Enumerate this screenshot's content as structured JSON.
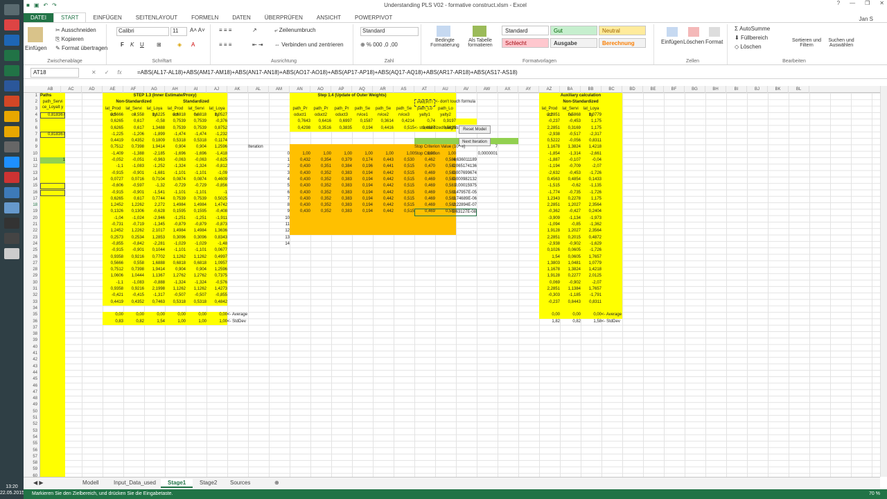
{
  "titlebar": {
    "title": "Understanding PLS V02 - formative construct.xlsm - Excel"
  },
  "clock": {
    "time": "13:20",
    "date": "22.05.2015"
  },
  "tabs": {
    "file": "DATEI",
    "start": "START",
    "insert": "EINFÜGEN",
    "layout": "SEITENLAYOUT",
    "formulas": "FORMELN",
    "data": "DATEN",
    "review": "ÜBERPRÜFEN",
    "view": "ANSICHT",
    "powerpivot": "POWERPIVOT",
    "user": "Jan S"
  },
  "ribbon": {
    "clipboard": {
      "label": "Zwischenablage",
      "paste": "Einfügen",
      "cut": "Ausschneiden",
      "copy": "Kopieren",
      "painter": "Format übertragen"
    },
    "font": {
      "label": "Schriftart",
      "name": "Calibri",
      "size": "11"
    },
    "align": {
      "label": "Ausrichtung",
      "wrap": "Zeilenumbruch",
      "merge": "Verbinden und zentrieren"
    },
    "number": {
      "label": "Zahl",
      "format": "Standard"
    },
    "styles": {
      "label": "Formatvorlagen",
      "cond": "Bedingte Formatierung",
      "table": "Als Tabelle formatieren",
      "s1": "Standard",
      "s2": "Gut",
      "s3": "Neutral",
      "s4": "Schlecht",
      "s5": "Ausgabe",
      "s6": "Berechnung"
    },
    "cells": {
      "label": "Zellen",
      "insert": "Einfügen",
      "delete": "Löschen",
      "format": "Format"
    },
    "edit": {
      "label": "Bearbeiten",
      "autosum": "AutoSumme",
      "fill": "Füllbereich",
      "clear": "Löschen",
      "sort": "Sortieren und Filtern",
      "find": "Suchen und Auswählen"
    }
  },
  "namebox": "AT18",
  "formula": "=ABS(AL17-AL18)+ABS(AM17-AM18)+ABS(AN17-AN18)+ABS(AO17-AO18)+ABS(AP17-AP18)+ABS(AQ17-AQ18)+ABS(AR17-AR18)+ABS(AS17-AS18)",
  "columns": [
    "AB",
    "AC",
    "AD",
    "AE",
    "AF",
    "AG",
    "AH",
    "AI",
    "AJ",
    "AK",
    "AL",
    "AM",
    "AN",
    "AO",
    "AP",
    "AQ",
    "AR",
    "AS",
    "AT",
    "AU",
    "AV",
    "AW",
    "AX",
    "AY",
    "AZ",
    "BA",
    "BB",
    "BC",
    "BD",
    "BE",
    "BF",
    "BG",
    "BH",
    "BI",
    "BJ",
    "BK",
    "BL"
  ],
  "sheet": {
    "paths_hdr": "Paths",
    "path_cell": "path_Servi ce_Loyalt y",
    "ab_vals": [
      "0,818367",
      "",
      "",
      "0,818367",
      "",
      "",
      "",
      "1",
      "",
      "",
      "",
      "",
      "",
      "",
      ""
    ],
    "step13": "STEP 1.3 (Inner Estimate/Proxy)",
    "nonstd": "Non-Standardized",
    "std": "Standardized",
    "hdr_lat": [
      "lat_Prod uct",
      "lat_Servi ce",
      "lat_Loya lty",
      "lat_Prod uct",
      "lat_Servi ce",
      "lat_Loya lty"
    ],
    "step14": "Step 1.4 (Update of Outer Weights)",
    "wert": "#WERT!",
    "dont_touch": "<- don't touch formula",
    "path_hdrs": [
      "path_Pr oduct1",
      "path_Pr oduct2",
      "path_Pr oduct3",
      "path_Se rvice1",
      "path_Se rvice2",
      "path_Se rvice3",
      "path_Lo yalty1",
      "path_Lo yalty2"
    ],
    "row4": [
      "0,7643",
      "0,6416",
      "0,6997",
      "0,1587",
      "0,3614",
      "0,4214",
      "0,74",
      "0,9197"
    ],
    "row5": [
      "0,4298",
      "0,3516",
      "0,3835",
      "0,194",
      "0,4416",
      "0,515",
      "0,4687",
      "0,5825"
    ],
    "std_weights": "<- standardized weights",
    "reset": "Reset Model",
    "next": "Next Iteration",
    "iteration": "Iteration",
    "stop_val": "Stop Criterion Value (10^-x)",
    "stop_num": "7",
    "stop_crit": "Stop Criterion",
    "stop_thr": "0,0000001",
    "iter_rows": [
      [
        "0",
        "1,00",
        "1,00",
        "1,00",
        "1,00",
        "1,00",
        "1,00",
        "1,00",
        "1,00",
        ""
      ],
      [
        "1",
        "0,432",
        "0,354",
        "0,379",
        "0,174",
        "0,443",
        "0,530",
        "0,462",
        "0,589",
        "4,636011189"
      ],
      [
        "2",
        "0,430",
        "0,351",
        "0,384",
        "0,196",
        "0,441",
        "0,515",
        "0,470",
        "0,582",
        "0,065174136"
      ],
      [
        "3",
        "0,430",
        "0,352",
        "0,383",
        "0,194",
        "0,442",
        "0,515",
        "0,469",
        "0,583",
        "0,007699674"
      ],
      [
        "4",
        "0,430",
        "0,352",
        "0,383",
        "0,194",
        "0,442",
        "0,515",
        "0,469",
        "0,583",
        "0,000982132"
      ],
      [
        "5",
        "0,430",
        "0,352",
        "0,383",
        "0,194",
        "0,442",
        "0,515",
        "0,469",
        "0,583",
        "0,00015975"
      ],
      [
        "6",
        "0,430",
        "0,352",
        "0,383",
        "0,194",
        "0,442",
        "0,515",
        "0,469",
        "0,583",
        "1,47957E-05"
      ],
      [
        "7",
        "0,430",
        "0,352",
        "0,383",
        "0,194",
        "0,442",
        "0,515",
        "0,469",
        "0,583",
        "1,74689E-06"
      ],
      [
        "8",
        "0,430",
        "0,352",
        "0,383",
        "0,194",
        "0,442",
        "0,515",
        "0,469",
        "0,583",
        "2,22894E-07"
      ],
      [
        "9",
        "0,430",
        "0,352",
        "0,383",
        "0,194",
        "0,442",
        "0,515",
        "0,469",
        "0,583",
        "2,63127E-08"
      ],
      [
        "10",
        "",
        "",
        "",
        "",
        "",
        "",
        "",
        "",
        ""
      ],
      [
        "11",
        "",
        "",
        "",
        "",
        "",
        "",
        "",
        "",
        ""
      ],
      [
        "12",
        "",
        "",
        "",
        "",
        "",
        "",
        "",
        "",
        ""
      ],
      [
        "13",
        "",
        "",
        "",
        "",
        "",
        "",
        "",
        "",
        ""
      ],
      [
        "14",
        "",
        "",
        "",
        "",
        "",
        "",
        "",
        "",
        ""
      ]
    ],
    "aux": "Auxiliary calculation",
    "left_rows": [
      [
        "0,5666",
        "0,558",
        "1,6225",
        "0,6818",
        "0,6818",
        "1,0527"
      ],
      [
        "0,6265",
        "0,617",
        "-0,58",
        "0,7539",
        "0,7539",
        "-0,376"
      ],
      [
        "0,6265",
        "0,617",
        "1,3488",
        "0,7539",
        "0,7539",
        "0,8752"
      ],
      [
        "-1,225",
        "-1,206",
        "-1,899",
        "-1,474",
        "-1,474",
        "-1,232"
      ],
      [
        "0,4419",
        "0,4352",
        "0,1809",
        "0,5318",
        "0,5318",
        "0,1174"
      ],
      [
        "0,7512",
        "0,7398",
        "1,9414",
        "0,904",
        "0,904",
        "1,2596"
      ],
      [
        "-1,409",
        "-1,388",
        "-2,185",
        "-1,696",
        "-1,696",
        "-1,418"
      ],
      [
        "-0,052",
        "-0,051",
        "-0,963",
        "-0,063",
        "-0,063",
        "-0,625"
      ],
      [
        "-1,1",
        "-1,083",
        "-1,252",
        "-1,324",
        "-1,324",
        "-0,812"
      ],
      [
        "-0,915",
        "-0,901",
        "-1,681",
        "-1,101",
        "-1,101",
        "-1,09"
      ],
      [
        "0,0727",
        "0,0716",
        "0,7104",
        "0,0874",
        "0,0874",
        "0,4609"
      ],
      [
        "-0,606",
        "-0,597",
        "-1,32",
        "-0,729",
        "-0,729",
        "-0,856"
      ],
      [
        "-0,915",
        "-0,901",
        "-1,541",
        "-1,101",
        "-1,101",
        "-1"
      ],
      [
        "0,6265",
        "0,617",
        "0,7744",
        "0,7539",
        "0,7539",
        "0,5025"
      ],
      [
        "1,2452",
        "1,2262",
        "2,272",
        "1,4984",
        "1,4984",
        "1,4742"
      ],
      [
        "0,1326",
        "0,1306",
        "-0,628",
        "0,1595",
        "0,1595",
        "-0,408"
      ],
      [
        "-1,04",
        "-1,024",
        "-2,946",
        "-1,251",
        "-1,251",
        "-1,911"
      ],
      [
        "-0,731",
        "-0,719",
        "-1,345",
        "-0,879",
        "-0,879",
        "-0,873"
      ],
      [
        "1,2452",
        "1,2262",
        "2,1017",
        "1,4984",
        "1,4984",
        "1,3636"
      ],
      [
        "0,2573",
        "0,2534",
        "1,2853",
        "0,3096",
        "0,3096",
        "0,8343"
      ],
      [
        "-0,855",
        "-0,842",
        "-2,281",
        "-1,029",
        "-1,029",
        "-1,48"
      ],
      [
        "-0,915",
        "-0,901",
        "0,1044",
        "-1,101",
        "-1,101",
        "0,0677"
      ],
      [
        "0,9358",
        "0,9216",
        "0,7702",
        "1,1262",
        "1,1262",
        "0,4997"
      ],
      [
        "0,5666",
        "0,558",
        "1,6888",
        "0,6818",
        "0,6818",
        "1,0957"
      ],
      [
        "0,7512",
        "0,7398",
        "1,9414",
        "0,904",
        "0,904",
        "1,2596"
      ],
      [
        "1,0606",
        "1,0444",
        "1,1367",
        "1,2762",
        "1,2762",
        "0,7375"
      ],
      [
        "-1,1",
        "-1,083",
        "-0,888",
        "-1,324",
        "-1,324",
        "-0,576"
      ],
      [
        "0,9358",
        "0,9216",
        "2,1998",
        "1,1262",
        "1,1262",
        "1,4273"
      ],
      [
        "-0,421",
        "-0,415",
        "-1,317",
        "-0,507",
        "-0,507",
        "-0,855"
      ],
      [
        "0,4419",
        "0,4352",
        "0,7463",
        "0,5318",
        "0,5318",
        "0,4842"
      ]
    ],
    "aux_rows": [
      [
        "2,2851",
        "0,5868",
        "1,0779"
      ],
      [
        "-0,237",
        "-0,453",
        "1,175"
      ],
      [
        "2,2851",
        "0,3169",
        "1,175"
      ],
      [
        "-2,938",
        "-0,517",
        "-2,317"
      ],
      [
        "0,5222",
        "-0,056",
        "0,8311"
      ],
      [
        "1,1678",
        "1,3824",
        "1,4218"
      ],
      [
        "-1,854",
        "-1,314",
        "-2,661"
      ],
      [
        "-1,887",
        "-0,107",
        "-0,04"
      ],
      [
        "-1,194",
        "-0,709",
        "-2,07"
      ],
      [
        "-2,632",
        "-0,453",
        "-1,726"
      ],
      [
        "0,4563",
        "0,4854",
        "0,1433"
      ],
      [
        "-1,515",
        "-0,62",
        "-1,135"
      ],
      [
        "-1,774",
        "-0,735",
        "-1,726"
      ],
      [
        "1,2343",
        "0,2278",
        "1,175"
      ],
      [
        "2,2851",
        "1,2027",
        "2,3564"
      ],
      [
        "-0,362",
        "-0,427",
        "0,2404"
      ],
      [
        "-3,909",
        "-1,134",
        "-1,973"
      ],
      [
        "-1,094",
        "-0,85",
        "-1,362"
      ],
      [
        "1,9128",
        "1,2027",
        "2,3564"
      ],
      [
        "2,2851",
        "0,2015",
        "0,4872"
      ],
      [
        "-2,938",
        "-0,902",
        "-1,629"
      ],
      [
        "0,1026",
        "0,0605",
        "-1,726"
      ],
      [
        "1,54",
        "0,0605",
        "1,7657"
      ],
      [
        "1,3803",
        "1,0481",
        "1,0779"
      ],
      [
        "1,1678",
        "1,3824",
        "1,4218"
      ],
      [
        "1,9128",
        "0,2277",
        "2,0125"
      ],
      [
        "0,069",
        "-0,902",
        "-2,07"
      ],
      [
        "2,2851",
        "1,1384",
        "1,7657"
      ],
      [
        "-0,303",
        "-1,185",
        "-1,791"
      ],
      [
        "-0,237",
        "0,8443",
        "0,8311"
      ]
    ],
    "avg_left": [
      "0,00",
      "0,00",
      "0,00",
      "0,00",
      "0,00",
      "0,00"
    ],
    "sd_left": [
      "0,83",
      "0,82",
      "1,54",
      "1,00",
      "1,00",
      "1,00"
    ],
    "avg_aux": [
      "0,00",
      "0,00",
      "0,00"
    ],
    "sd_aux": [
      "1,82",
      "0,82",
      "1,58"
    ],
    "avg_lbl": "<- Average",
    "sd_lbl": "<- StdDev"
  },
  "sheettabs": [
    "Modell",
    "Input_Data_used",
    "Stage1",
    "Stage2",
    "Sources"
  ],
  "status": {
    "msg": "Markieren Sie den Zielbereich, und drücken Sie die Eingabetaste.",
    "zoom": "70 %"
  }
}
